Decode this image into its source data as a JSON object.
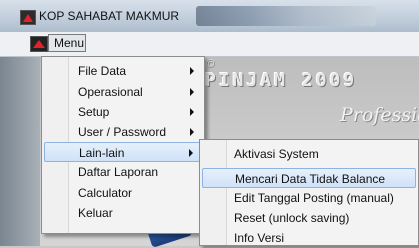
{
  "window": {
    "title": "KOP SAHABAT MAKMUR",
    "icon": "app-logo-icon"
  },
  "menubar": {
    "menu_label": "Menu",
    "icon": "app-logo-icon"
  },
  "background": {
    "brand_small": "©",
    "brand": "PINJAM 2009",
    "tagline": "Professio"
  },
  "main_menu": {
    "items": [
      {
        "label": "File Data",
        "submenu": true
      },
      {
        "label": "Operasional",
        "submenu": true
      },
      {
        "label": "Setup",
        "submenu": true
      },
      {
        "label": "User / Password",
        "submenu": true
      },
      {
        "label": "Lain-lain",
        "submenu": true,
        "highlighted": true
      },
      {
        "label": "Daftar Laporan",
        "submenu": false
      },
      {
        "label": "Calculator",
        "submenu": false
      },
      {
        "label": "Keluar",
        "submenu": false
      }
    ]
  },
  "sub_menu": {
    "items": [
      {
        "label": "Aktivasi System"
      },
      {
        "label": "Mencari Data Tidak Balance",
        "highlighted": true
      },
      {
        "label": "Edit Tanggal Posting (manual)"
      },
      {
        "label": "Reset (unlock saving)"
      },
      {
        "label": "Info Versi"
      }
    ]
  },
  "colors": {
    "highlight_bg": "#cfe2f8",
    "highlight_border": "#8fb3e0",
    "menu_bg": "#f3f3f3"
  }
}
